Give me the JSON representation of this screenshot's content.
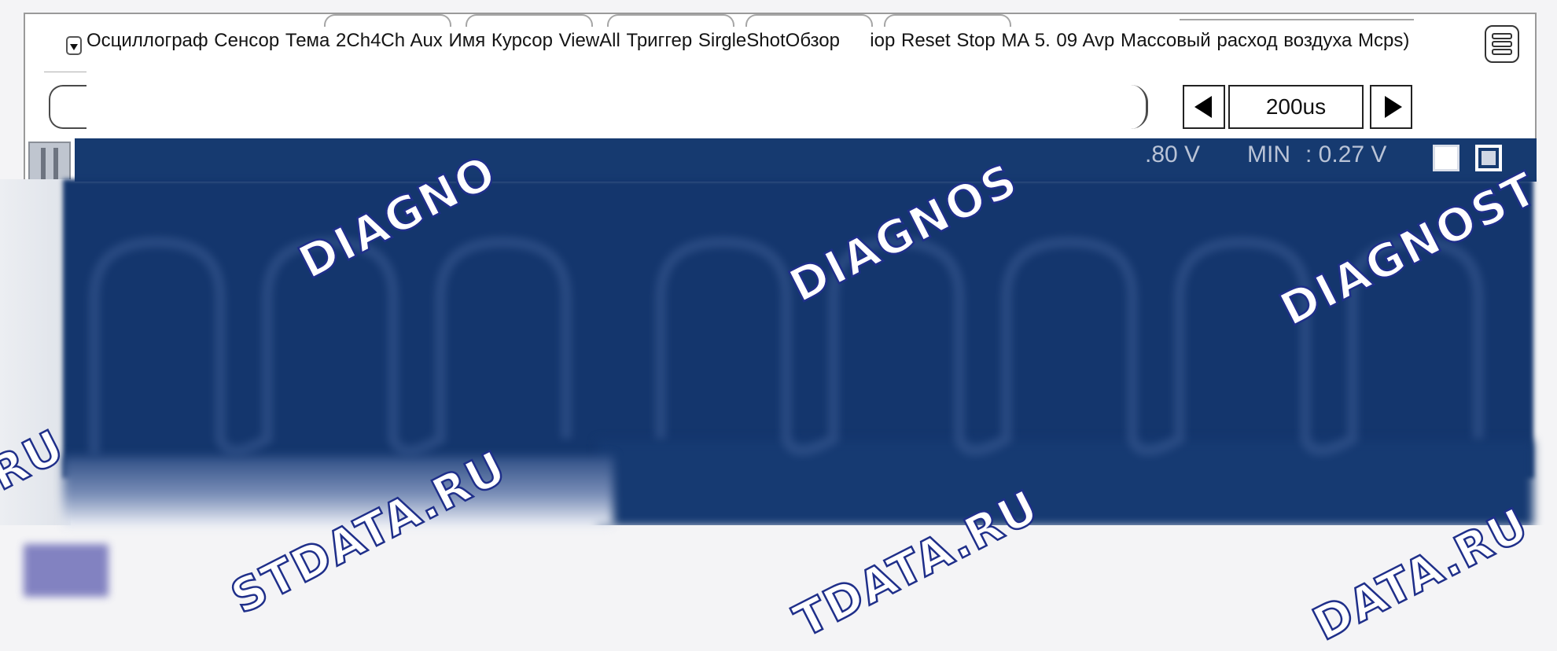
{
  "menu": {
    "text": "Осциллограф Сенсор Тема 2Ch4Ch Aux Имя Курсор ViewAll Триггер SirgleShotОбзор     iop Reset Stop MA 5. 09 Avp Массовый расход воздуха Mcps)"
  },
  "timebase": {
    "value": "200us"
  },
  "status": {
    "max_partial": ".80 V",
    "min_label": "MIN",
    "min_value": ": 0.27 V"
  },
  "watermarks": {
    "a": "DIAGNO",
    "b": "DIAGNOS",
    "c": "DIAGNOST",
    "d": ".RU",
    "e": "STDATA.RU",
    "f": "TDATA.RU",
    "g": "DATA.RU"
  },
  "icons": [
    "dropdown-arrow-icon",
    "hamburger-menu-icon",
    "arrow-left-icon",
    "arrow-right-icon",
    "maximize-icon",
    "restore-icon"
  ],
  "colors": {
    "scope_background": "#163a70",
    "watermark_stroke": "#1f2f8a"
  }
}
